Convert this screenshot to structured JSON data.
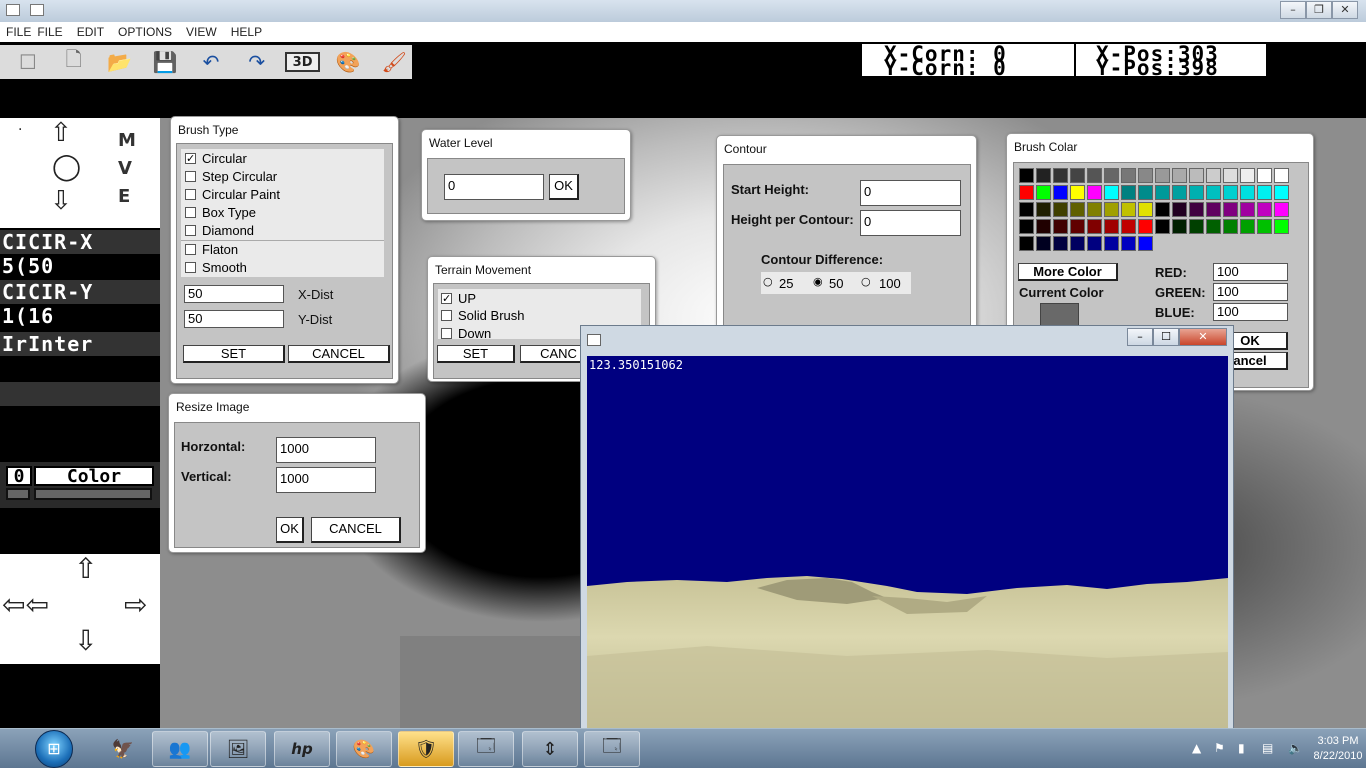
{
  "menubar": {
    "items": [
      "FILE",
      "FILE",
      "EDIT",
      "OPTIONS",
      "VIEW",
      "HELP"
    ]
  },
  "toolbar": {
    "icons": [
      "new-blank-icon",
      "new-page-icon",
      "open-folder-icon",
      "save-icon",
      "undo-icon",
      "redo-icon",
      "3d-icon",
      "palette-icon",
      "paint-brush-icon"
    ],
    "three_d_label": "3D"
  },
  "coords": {
    "x_corn": "X-Corn: 0",
    "y_corn": "Y-Corn: 0",
    "x_pos": "X-Pos:303",
    "y_pos": "Y-Pos:398"
  },
  "left_panel": {
    "letters": [
      "M",
      "V",
      "E"
    ],
    "cicir_x_label": "CICIR-X",
    "cicir_x_value": "5(50",
    "cicir_y_label": "CICIR-Y",
    "cicir_y_value": "1(16",
    "irinter": "IrInter",
    "color_prefix": "0",
    "color_label": "Color"
  },
  "brush_type": {
    "title": "Brush Type",
    "options": [
      {
        "label": "Circular",
        "checked": true
      },
      {
        "label": "Step Circular",
        "checked": false
      },
      {
        "label": "Circular Paint",
        "checked": false
      },
      {
        "label": "Box Type",
        "checked": false
      },
      {
        "label": "Diamond",
        "checked": false
      },
      {
        "label": "Flaton",
        "checked": false
      },
      {
        "label": "Smooth",
        "checked": false
      }
    ],
    "x_dist_value": "50",
    "x_dist_label": "X-Dist",
    "y_dist_value": "50",
    "y_dist_label": "Y-Dist",
    "set_label": "SET",
    "cancel_label": "CANCEL"
  },
  "water_level": {
    "title": "Water Level",
    "value": "0",
    "ok_label": "OK"
  },
  "terrain_movement": {
    "title": "Terrain Movement",
    "options": [
      {
        "label": "UP",
        "checked": true
      },
      {
        "label": "Solid Brush",
        "checked": false
      },
      {
        "label": "Down",
        "checked": false
      }
    ],
    "set_label": "SET",
    "cancel_label": "CANC"
  },
  "resize_image": {
    "title": "Resize Image",
    "horizontal_label": "Horzontal:",
    "horizontal_value": "1000",
    "vertical_label": "Vertical:",
    "vertical_value": "1000",
    "ok_label": "OK",
    "cancel_label": "CANCEL"
  },
  "contour": {
    "title": "Contour",
    "start_height_label": "Start Height:",
    "start_height_value": "0",
    "height_per_contour_label": "Height per Contour:",
    "height_per_contour_value": "0",
    "difference_label": "Contour Difference:",
    "difference_options": [
      {
        "label": "25",
        "selected": false
      },
      {
        "label": "50",
        "selected": true
      },
      {
        "label": "100",
        "selected": false
      }
    ]
  },
  "brush_color": {
    "title": "Brush Colar",
    "palette_rows": [
      [
        "#000000",
        "#222222",
        "#333333",
        "#444444",
        "#555555",
        "#666666",
        "#777777",
        "#888888",
        "#999999",
        "#aaaaaa",
        "#bbbbbb",
        "#cccccc",
        "#dddddd",
        "#eeeeee",
        "#ffffff",
        "#ffffff"
      ],
      [
        "#ff0000",
        "#00ff00",
        "#0000ff",
        "#ffff00",
        "#ff00ff",
        "#00ffff",
        "#008080",
        "#008b8b",
        "#009999",
        "#00a0a0",
        "#00b0b0",
        "#00c0c0",
        "#00d0d0",
        "#00e0e0",
        "#00f0f0",
        "#00ffff"
      ],
      [
        "#000000",
        "#202000",
        "#404000",
        "#606000",
        "#808000",
        "#a0a000",
        "#c0c000",
        "#e0e000",
        "#000000",
        "#200020",
        "#400040",
        "#600060",
        "#800080",
        "#a000a0",
        "#c000c0",
        "#ff00ff"
      ],
      [
        "#000000",
        "#200000",
        "#400000",
        "#600000",
        "#800000",
        "#a00000",
        "#c00000",
        "#ff0000",
        "#000000",
        "#002000",
        "#004000",
        "#006000",
        "#008000",
        "#00a000",
        "#00c000",
        "#00ff00"
      ],
      [
        "#000000",
        "#000020",
        "#000040",
        "#000060",
        "#000080",
        "#0000a0",
        "#0000c0",
        "#0000ff"
      ]
    ],
    "more_color_label": "More Color",
    "current_color_label": "Current Color",
    "current_color": "#696969",
    "red_label": "RED:",
    "red_value": "100",
    "green_label": "GREEN:",
    "green_value": "100",
    "blue_label": "BLUE:",
    "blue_value": "100",
    "ok_label": "OK",
    "cancel_label": "ancel"
  },
  "view_window": {
    "readout": "123.350151062",
    "sky_color": "#000080",
    "terrain_color": "#d8d3a6"
  },
  "taskbar": {
    "apps": [
      "stamp-app-icon",
      "network-users-icon",
      "slideshow-icon",
      "hp-icon",
      "paint-icon",
      "shield-icon",
      "window-app-icon",
      "transfer-icon",
      "window-app-icon"
    ],
    "hp_label": "hp",
    "time": "3:03 PM",
    "date": "8/22/2010"
  }
}
